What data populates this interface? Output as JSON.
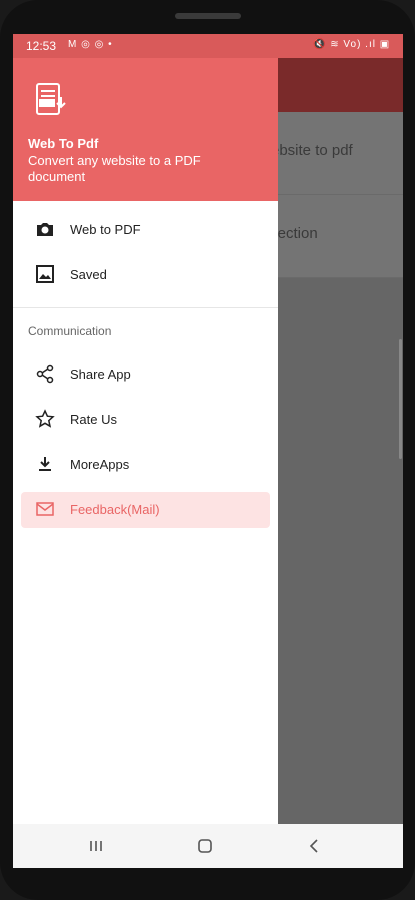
{
  "status_bar": {
    "time": "12:53",
    "left_icons": "M ◎ ◎ •",
    "right_icons": "🔇 ≋ Vo) .ıl ▣"
  },
  "background": {
    "card1_text": "ebsite to pdf",
    "card2_text": "llection"
  },
  "drawer": {
    "header": {
      "title": "Web To Pdf",
      "subtitle": "Convert any website to a PDF document"
    },
    "items": [
      {
        "label": "Web to PDF",
        "icon": "camera-icon"
      },
      {
        "label": "Saved",
        "icon": "image-icon"
      }
    ],
    "section_title": "Communication",
    "communication_items": [
      {
        "label": "Share App",
        "icon": "share-icon"
      },
      {
        "label": "Rate Us",
        "icon": "star-icon"
      },
      {
        "label": "MoreApps",
        "icon": "download-icon"
      },
      {
        "label": "Feedback(Mail)",
        "icon": "mail-icon",
        "active": true
      }
    ]
  },
  "colors": {
    "accent": "#e96565",
    "active_bg": "#fde3e3"
  }
}
